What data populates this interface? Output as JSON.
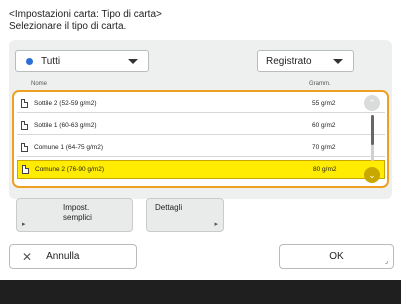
{
  "header": {
    "title": "<Impostazioni carta: Tipo di carta>",
    "subtitle": "Selezionare il tipo di carta."
  },
  "filters": {
    "type_value": "Tutti",
    "sort_value": "Registrato"
  },
  "list": {
    "col_name": "Nome",
    "col_gram": "Gramm.",
    "rows": [
      {
        "name": "Sottile 2 (52-59 g/m2)",
        "gram": "55 g/m2"
      },
      {
        "name": "Sottile 1 (60-63 g/m2)",
        "gram": "60 g/m2"
      },
      {
        "name": "Comune 1 (64-75 g/m2)",
        "gram": "70 g/m2"
      },
      {
        "name": "Comune 2 (76-90 g/m2)",
        "gram": "80 g/m2"
      }
    ]
  },
  "buttons": {
    "impost_line1": "Impost.",
    "impost_line2": "semplici",
    "dettagli": "Dettagli",
    "annulla": "Annulla",
    "ok": "OK"
  },
  "icons": {
    "close": "close-icon",
    "scroll_up": "chevron-up-icon",
    "scroll_down": "chevron-down-icon"
  }
}
